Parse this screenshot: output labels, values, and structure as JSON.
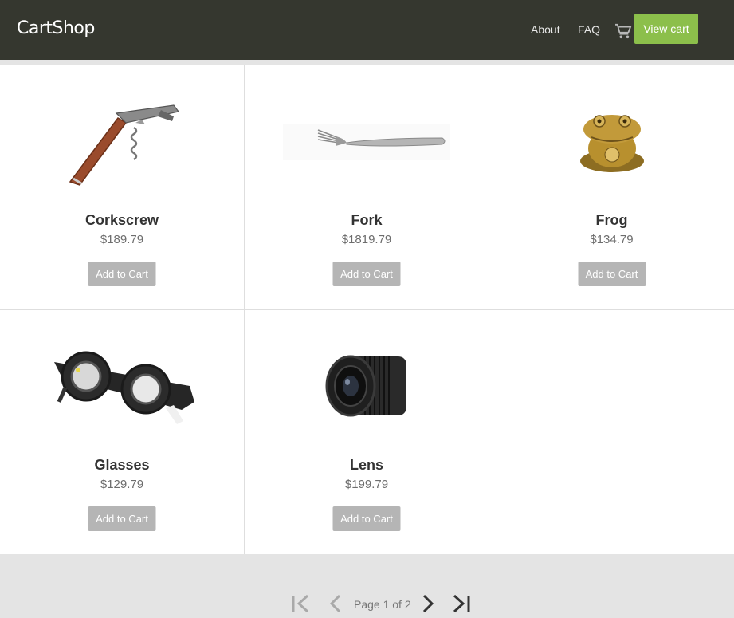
{
  "header": {
    "brand": "CartShop",
    "nav": [
      {
        "label": "About"
      },
      {
        "label": "FAQ"
      }
    ],
    "view_cart_label": "View cart",
    "cart_icon": "shopping-cart-icon"
  },
  "colors": {
    "header_bg": "#35372f",
    "accent": "#8cbf4b",
    "button_gray": "#b5b5b5",
    "page_bg": "#e4e4e4"
  },
  "products": [
    {
      "name": "Corkscrew",
      "price": "$189.79",
      "add_label": "Add to Cart",
      "image": "corkscrew-image"
    },
    {
      "name": "Fork",
      "price": "$1819.79",
      "add_label": "Add to Cart",
      "image": "fork-image"
    },
    {
      "name": "Frog",
      "price": "$134.79",
      "add_label": "Add to Cart",
      "image": "frog-figurine-image"
    },
    {
      "name": "Glasses",
      "price": "$129.79",
      "add_label": "Add to Cart",
      "image": "trial-glasses-image"
    },
    {
      "name": "Lens",
      "price": "$199.79",
      "add_label": "Add to Cart",
      "image": "camera-lens-image"
    }
  ],
  "pagination": {
    "label": "Page 1 of 2",
    "icons": [
      "first-page-icon",
      "previous-page-icon",
      "next-page-icon",
      "last-page-icon"
    ]
  }
}
